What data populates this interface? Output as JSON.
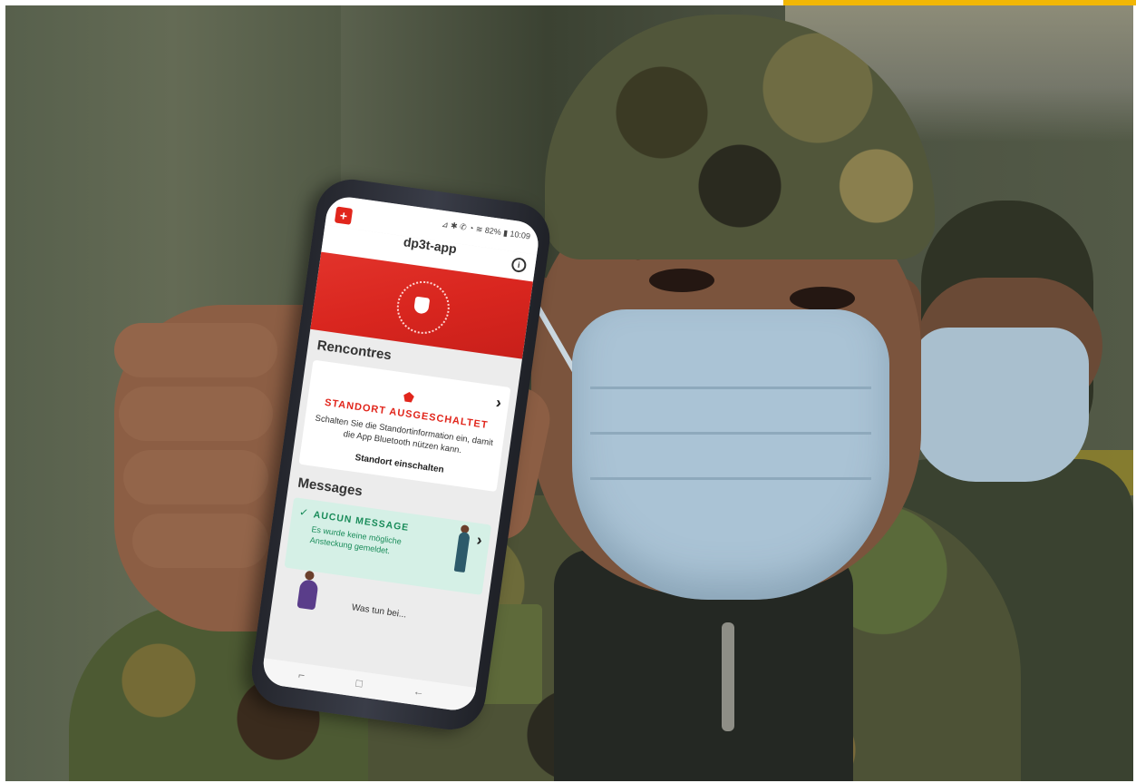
{
  "phone": {
    "app_title": "dp3t-app",
    "status_icons": "⊿ ✱ ✆ ◔ ≋ 82% ▮ 10:09",
    "info_icon": "i",
    "rencontres": {
      "title": "Rencontres",
      "warning_heading": "STANDORT AUSGESCHALTET",
      "warning_body": "Schalten Sie die Standortinformation ein, damit die App Bluetooth nützen kann.",
      "warning_action": "Standort einschalten"
    },
    "messages": {
      "title": "Messages",
      "heading": "AUCUN MESSAGE",
      "body": "Es wurde keine mögliche Ansteckung gemeldet."
    },
    "bottom_card_text": "Was tun bei...",
    "chevron": "›"
  },
  "colors": {
    "brand_red": "#e1261c",
    "message_green": "#1a8c5a",
    "accent_yellow": "#f2b705"
  }
}
